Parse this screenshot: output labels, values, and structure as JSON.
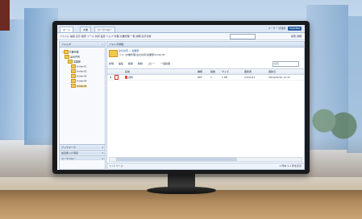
{
  "app": {
    "tabs": [
      {
        "label": "ホーム"
      },
      {
        "label": "文書"
      },
      {
        "label": "ワークフロー"
      }
    ],
    "top_right": {
      "user": "ユーザー 管理者",
      "brand": "DeskNet"
    }
  },
  "menubar": {
    "text": "ファイル 編集 表示 検索 ツール 共有 設定 ヘルプ 管理 文書管理 一覧 詳細 表示切替",
    "search_placeholder": "ファイル検索",
    "right": "検索 詳細"
  },
  "sidebar": {
    "title": "フォルダ",
    "tree": [
      {
        "label": "文書管理"
      },
      {
        "label": "全社共有"
      },
      {
        "label": "営業部"
      },
      {
        "label": "folder01"
      },
      {
        "label": "folder02"
      },
      {
        "label": "folder03"
      },
      {
        "label": "folder04"
      },
      {
        "label": "folder05"
      }
    ],
    "sections": [
      {
        "label": "ブックマーク"
      },
      {
        "label": "最近使った項目"
      },
      {
        "label": "ワークフロー"
      }
    ]
  },
  "main": {
    "title": "フォルダ詳細",
    "folder_name": "全社共有 > 営業部",
    "folder_path": "パス: /文書管理/全社共有/営業部/folder05",
    "toolbar": [
      "新規",
      "編集",
      "削除",
      "移動",
      "コピー",
      "一括処理"
    ],
    "search_placeholder": "検索",
    "columns": [
      "名前",
      "種類",
      "版数",
      "サイズ",
      "更新者",
      "更新日"
    ],
    "rows": [
      {
        "name": "資料",
        "type": "PDF",
        "version": "1",
        "size": "1 KB",
        "updated_by": "admin01",
        "updated_at": "2014/01/10 11:11"
      }
    ],
    "pager": "1 / 1 ページ",
    "page_info": "1 件中 1-1 件を表示"
  },
  "colors": {
    "accent": "#2d5f9e",
    "folder": "#f2c94c",
    "pdf": "#e74c3c"
  }
}
